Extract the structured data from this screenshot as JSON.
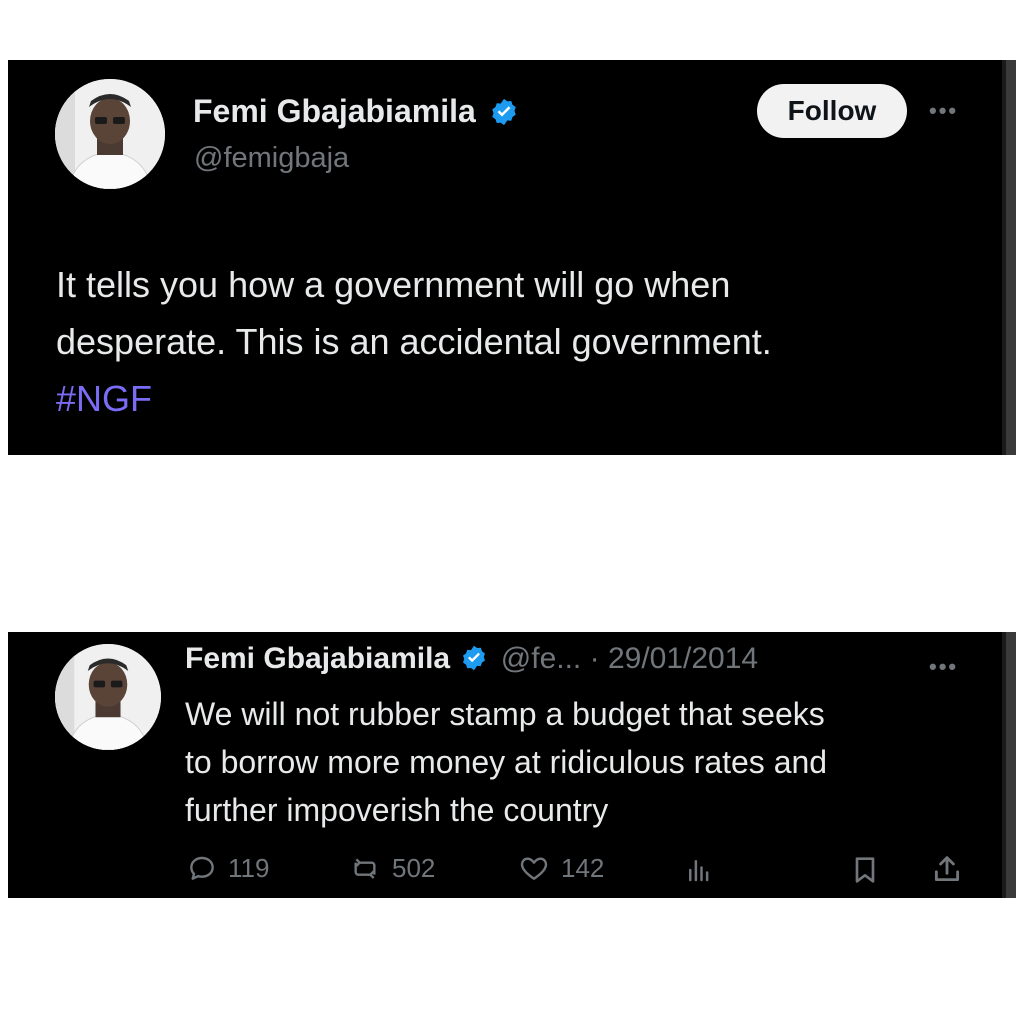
{
  "tweet_top": {
    "name": "Femi Gbajabiamila",
    "handle": "@femigbaja",
    "follow_label": "Follow",
    "more_label": "•••",
    "text_lines": [
      "It tells you how a government will go when",
      "desperate. This is an accidental government."
    ],
    "hashtag": "#NGF"
  },
  "tweet_bottom": {
    "name": "Femi Gbajabiamila",
    "handle_truncated": "@fe...",
    "separator": "·",
    "date": "29/01/2014",
    "more_label": "•••",
    "text_lines": [
      "We will not rubber stamp a budget that seeks",
      "to borrow more money at ridiculous rates and",
      "further impoverish the country"
    ],
    "actions": {
      "replies": "119",
      "reposts": "502",
      "likes": "142"
    }
  },
  "icons": [
    "verified-badge-icon",
    "reply-icon",
    "repost-icon",
    "like-icon",
    "views-icon",
    "bookmark-icon",
    "share-icon",
    "more-icon"
  ],
  "colors": {
    "background": "#000000",
    "text": "#e7e9ea",
    "secondary_text": "#71767b",
    "verified_blue": "#1d9bf0",
    "hashtag": "#7a6cf5",
    "follow_button_bg": "#f2f2f2"
  }
}
